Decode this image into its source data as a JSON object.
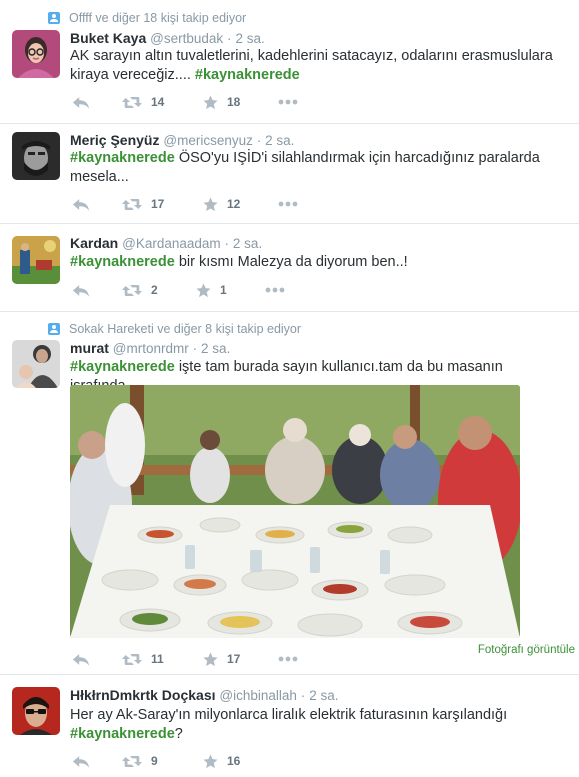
{
  "tweets": [
    {
      "context": "Offff ve diğer 18 kişi takip ediyor",
      "name": "Buket Kaya",
      "handle": "@sertbudak",
      "dot": "·",
      "time": "2 sa.",
      "text": "AK sarayın altın tuvaletlerini, kadehlerini satacayız, odalarını erasmuslulara kiraya vereceğiz....",
      "hashtag": "#kaynaknerede",
      "retweets": "14",
      "favorites": "18"
    },
    {
      "name": "Meriç Şenyüz",
      "handle": "@mericsenyuz",
      "dot": "·",
      "time": "2 sa.",
      "hashtag": "#kaynaknerede",
      "text": "ÖSO'yu IŞİD'i silahlandırmak için harcadığınız paralarda mesela...",
      "retweets": "17",
      "favorites": "12"
    },
    {
      "name": "Kardan",
      "handle": "@Kardanaadam",
      "dot": "·",
      "time": "2 sa.",
      "hashtag": "#kaynaknerede",
      "text": "bir kısmı Malezya da diyorum ben..!",
      "retweets": "2",
      "favorites": "1"
    },
    {
      "context": "Sokak Hareketi ve diğer 8 kişi takip ediyor",
      "name": "murat",
      "handle": "@mrtonrdmr",
      "dot": "·",
      "time": "2 sa.",
      "hashtag": "#kaynaknerede",
      "text": "işte tam burada sayın kullanıcı.tam da bu masanın israfında...",
      "retweets": "11",
      "favorites": "17",
      "view_photo": "Fotoğrafı görüntüle"
    },
    {
      "name": "HłkłrnDmkrtk Doçkası",
      "handle": "@ichbinallah",
      "dot": "·",
      "time": "2 sa.",
      "text": "Her ay Ak-Saray'ın milyonlarca liralık elektrik faturasının karşılandığı",
      "hashtag": "#kaynaknerede",
      "text_end": "?",
      "retweets": "9",
      "favorites": "16"
    }
  ],
  "icons": {
    "reply": "reply-icon",
    "retweet": "retweet-icon",
    "favorite": "star-icon",
    "more": "more-icon",
    "context": "user-follow-icon"
  },
  "colors": {
    "hashtag": "#3b9136",
    "meta": "#8899a6",
    "text": "#292f33",
    "context_icon": "#55acee"
  }
}
